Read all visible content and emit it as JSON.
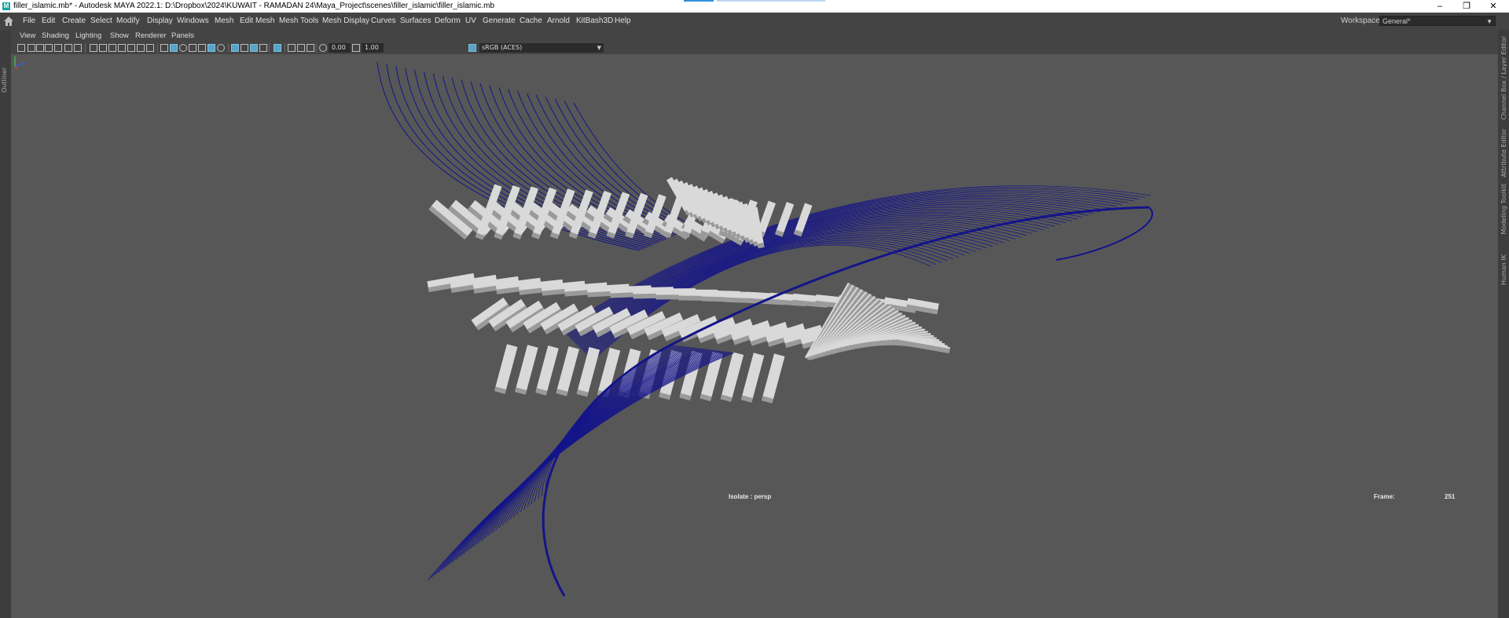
{
  "titlebar": {
    "title": "filler_islamic.mb* - Autodesk MAYA 2022.1: D:\\Dropbox\\2024\\KUWAIT - RAMADAN 24\\Maya_Project\\scenes\\filler_islamic\\filler_islamic.mb",
    "minimize": "–",
    "restore": "❒",
    "close": "✕"
  },
  "menubar": {
    "items": [
      "File",
      "Edit",
      "Create",
      "Select",
      "Modify",
      "Display",
      "Windows",
      "Mesh",
      "Edit Mesh",
      "Mesh Tools",
      "Mesh Display",
      "Curves",
      "Surfaces",
      "Deform",
      "UV",
      "Generate",
      "Cache",
      "Arnold",
      "KitBash3D",
      "Help"
    ],
    "workspace_label": "Workspace:",
    "workspace_value": "General*"
  },
  "left_tabs": [
    "Outliner"
  ],
  "right_tabs": [
    "Channel Box / Layer Editor",
    "Attribute Editor",
    "Modeling Toolkit",
    "Human IK"
  ],
  "panel_menu": [
    "View",
    "Shading",
    "Lighting",
    "Show",
    "Renderer",
    "Panels"
  ],
  "toolbar": {
    "exposure": "0.00",
    "gamma": "1.00",
    "color_space": "sRGB (ACES)"
  },
  "viewport": {
    "isolate_label": "Isolate : persp",
    "frame_label": "Frame:",
    "frame_value": "251"
  },
  "colors": {
    "curve": "#14148a",
    "mesh_light": "#d9d9d9",
    "mesh_dark": "#9a9a9a",
    "viewport_bg": "#575757",
    "ui_bg": "#444444"
  }
}
